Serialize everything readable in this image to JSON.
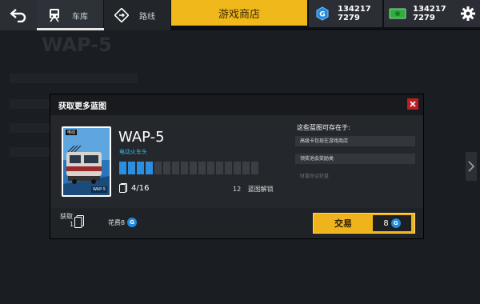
{
  "topbar": {
    "tabs": [
      {
        "label": "车库",
        "icon": "train-icon",
        "active": true
      },
      {
        "label": "路线",
        "icon": "route-sign-icon",
        "active": false
      }
    ],
    "shop_label": "游戏商店",
    "currencies": [
      {
        "icon": "blueprint-coin-icon",
        "line1": "134217",
        "line2": "7279",
        "color": "#1f8be0"
      },
      {
        "icon": "cash-icon",
        "line1": "134217",
        "line2": "7279",
        "color": "#2fae3d"
      }
    ]
  },
  "background": {
    "title": "WAP-5"
  },
  "modal": {
    "title": "获取更多蓝图",
    "card": {
      "badge": "电动",
      "meta": "WAP-5"
    },
    "train_name": "WAP-5",
    "train_subtitle": "电动火车头",
    "blueprints": {
      "owned": 4,
      "required": 16,
      "text": "4/16"
    },
    "unlock": {
      "count": "12",
      "label": "蓝图解锁"
    },
    "sources": {
      "title": "这些蓝图可存在于:",
      "items": [
        {
          "label": "高级卡包现在游戏商店",
          "available": true
        },
        {
          "label": "领奖池会奖励类",
          "available": true
        },
        {
          "label": "财富命运轮盘",
          "available": false
        }
      ]
    },
    "footer": {
      "obtain_label": "获取",
      "obtain_count": "1",
      "cost_label": "花费8",
      "trade_label": "交易",
      "trade_price": "8"
    }
  },
  "colors": {
    "accent_yellow": "#f0b81b",
    "accent_blue": "#2c8ee0",
    "close_red": "#b81e24"
  }
}
